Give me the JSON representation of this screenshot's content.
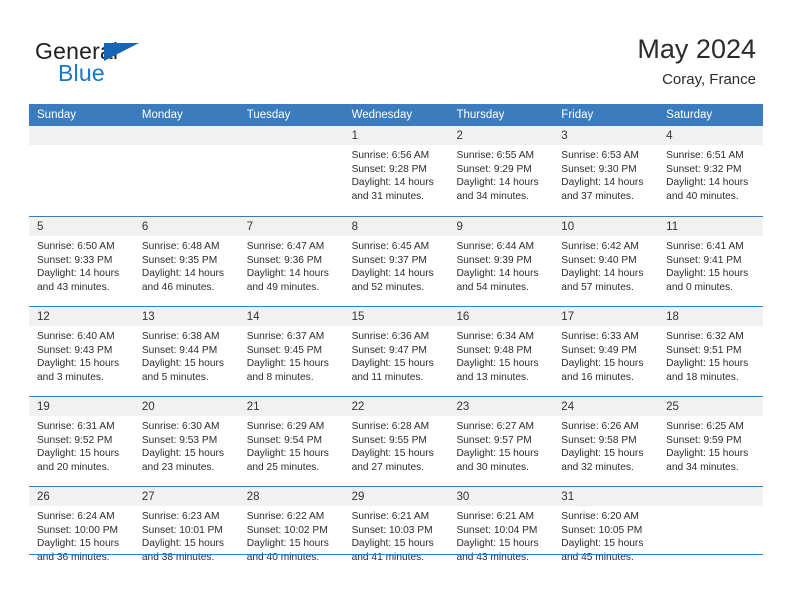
{
  "brand": {
    "name_top": "General",
    "name_bottom": "Blue",
    "color_dark": "#231f20",
    "color_blue": "#1878c8"
  },
  "header": {
    "title": "May 2024",
    "subtitle": "Coray, France"
  },
  "theme": {
    "header_blue": "#3a7cbe",
    "day_band": "#f1f1f1",
    "text": "#2d2d2d"
  },
  "weekdays": [
    "Sunday",
    "Monday",
    "Tuesday",
    "Wednesday",
    "Thursday",
    "Friday",
    "Saturday"
  ],
  "weeks": [
    [
      {
        "day": "",
        "lines": [
          "",
          "",
          "",
          ""
        ]
      },
      {
        "day": "",
        "lines": [
          "",
          "",
          "",
          ""
        ]
      },
      {
        "day": "",
        "lines": [
          "",
          "",
          "",
          ""
        ]
      },
      {
        "day": "1",
        "lines": [
          "Sunrise: 6:56 AM",
          "Sunset: 9:28 PM",
          "Daylight: 14 hours",
          "and 31 minutes."
        ]
      },
      {
        "day": "2",
        "lines": [
          "Sunrise: 6:55 AM",
          "Sunset: 9:29 PM",
          "Daylight: 14 hours",
          "and 34 minutes."
        ]
      },
      {
        "day": "3",
        "lines": [
          "Sunrise: 6:53 AM",
          "Sunset: 9:30 PM",
          "Daylight: 14 hours",
          "and 37 minutes."
        ]
      },
      {
        "day": "4",
        "lines": [
          "Sunrise: 6:51 AM",
          "Sunset: 9:32 PM",
          "Daylight: 14 hours",
          "and 40 minutes."
        ]
      }
    ],
    [
      {
        "day": "5",
        "lines": [
          "Sunrise: 6:50 AM",
          "Sunset: 9:33 PM",
          "Daylight: 14 hours",
          "and 43 minutes."
        ]
      },
      {
        "day": "6",
        "lines": [
          "Sunrise: 6:48 AM",
          "Sunset: 9:35 PM",
          "Daylight: 14 hours",
          "and 46 minutes."
        ]
      },
      {
        "day": "7",
        "lines": [
          "Sunrise: 6:47 AM",
          "Sunset: 9:36 PM",
          "Daylight: 14 hours",
          "and 49 minutes."
        ]
      },
      {
        "day": "8",
        "lines": [
          "Sunrise: 6:45 AM",
          "Sunset: 9:37 PM",
          "Daylight: 14 hours",
          "and 52 minutes."
        ]
      },
      {
        "day": "9",
        "lines": [
          "Sunrise: 6:44 AM",
          "Sunset: 9:39 PM",
          "Daylight: 14 hours",
          "and 54 minutes."
        ]
      },
      {
        "day": "10",
        "lines": [
          "Sunrise: 6:42 AM",
          "Sunset: 9:40 PM",
          "Daylight: 14 hours",
          "and 57 minutes."
        ]
      },
      {
        "day": "11",
        "lines": [
          "Sunrise: 6:41 AM",
          "Sunset: 9:41 PM",
          "Daylight: 15 hours",
          "and 0 minutes."
        ]
      }
    ],
    [
      {
        "day": "12",
        "lines": [
          "Sunrise: 6:40 AM",
          "Sunset: 9:43 PM",
          "Daylight: 15 hours",
          "and 3 minutes."
        ]
      },
      {
        "day": "13",
        "lines": [
          "Sunrise: 6:38 AM",
          "Sunset: 9:44 PM",
          "Daylight: 15 hours",
          "and 5 minutes."
        ]
      },
      {
        "day": "14",
        "lines": [
          "Sunrise: 6:37 AM",
          "Sunset: 9:45 PM",
          "Daylight: 15 hours",
          "and 8 minutes."
        ]
      },
      {
        "day": "15",
        "lines": [
          "Sunrise: 6:36 AM",
          "Sunset: 9:47 PM",
          "Daylight: 15 hours",
          "and 11 minutes."
        ]
      },
      {
        "day": "16",
        "lines": [
          "Sunrise: 6:34 AM",
          "Sunset: 9:48 PM",
          "Daylight: 15 hours",
          "and 13 minutes."
        ]
      },
      {
        "day": "17",
        "lines": [
          "Sunrise: 6:33 AM",
          "Sunset: 9:49 PM",
          "Daylight: 15 hours",
          "and 16 minutes."
        ]
      },
      {
        "day": "18",
        "lines": [
          "Sunrise: 6:32 AM",
          "Sunset: 9:51 PM",
          "Daylight: 15 hours",
          "and 18 minutes."
        ]
      }
    ],
    [
      {
        "day": "19",
        "lines": [
          "Sunrise: 6:31 AM",
          "Sunset: 9:52 PM",
          "Daylight: 15 hours",
          "and 20 minutes."
        ]
      },
      {
        "day": "20",
        "lines": [
          "Sunrise: 6:30 AM",
          "Sunset: 9:53 PM",
          "Daylight: 15 hours",
          "and 23 minutes."
        ]
      },
      {
        "day": "21",
        "lines": [
          "Sunrise: 6:29 AM",
          "Sunset: 9:54 PM",
          "Daylight: 15 hours",
          "and 25 minutes."
        ]
      },
      {
        "day": "22",
        "lines": [
          "Sunrise: 6:28 AM",
          "Sunset: 9:55 PM",
          "Daylight: 15 hours",
          "and 27 minutes."
        ]
      },
      {
        "day": "23",
        "lines": [
          "Sunrise: 6:27 AM",
          "Sunset: 9:57 PM",
          "Daylight: 15 hours",
          "and 30 minutes."
        ]
      },
      {
        "day": "24",
        "lines": [
          "Sunrise: 6:26 AM",
          "Sunset: 9:58 PM",
          "Daylight: 15 hours",
          "and 32 minutes."
        ]
      },
      {
        "day": "25",
        "lines": [
          "Sunrise: 6:25 AM",
          "Sunset: 9:59 PM",
          "Daylight: 15 hours",
          "and 34 minutes."
        ]
      }
    ],
    [
      {
        "day": "26",
        "lines": [
          "Sunrise: 6:24 AM",
          "Sunset: 10:00 PM",
          "Daylight: 15 hours",
          "and 36 minutes."
        ]
      },
      {
        "day": "27",
        "lines": [
          "Sunrise: 6:23 AM",
          "Sunset: 10:01 PM",
          "Daylight: 15 hours",
          "and 38 minutes."
        ]
      },
      {
        "day": "28",
        "lines": [
          "Sunrise: 6:22 AM",
          "Sunset: 10:02 PM",
          "Daylight: 15 hours",
          "and 40 minutes."
        ]
      },
      {
        "day": "29",
        "lines": [
          "Sunrise: 6:21 AM",
          "Sunset: 10:03 PM",
          "Daylight: 15 hours",
          "and 41 minutes."
        ]
      },
      {
        "day": "30",
        "lines": [
          "Sunrise: 6:21 AM",
          "Sunset: 10:04 PM",
          "Daylight: 15 hours",
          "and 43 minutes."
        ]
      },
      {
        "day": "31",
        "lines": [
          "Sunrise: 6:20 AM",
          "Sunset: 10:05 PM",
          "Daylight: 15 hours",
          "and 45 minutes."
        ]
      },
      {
        "day": "",
        "lines": [
          "",
          "",
          "",
          ""
        ]
      }
    ]
  ]
}
